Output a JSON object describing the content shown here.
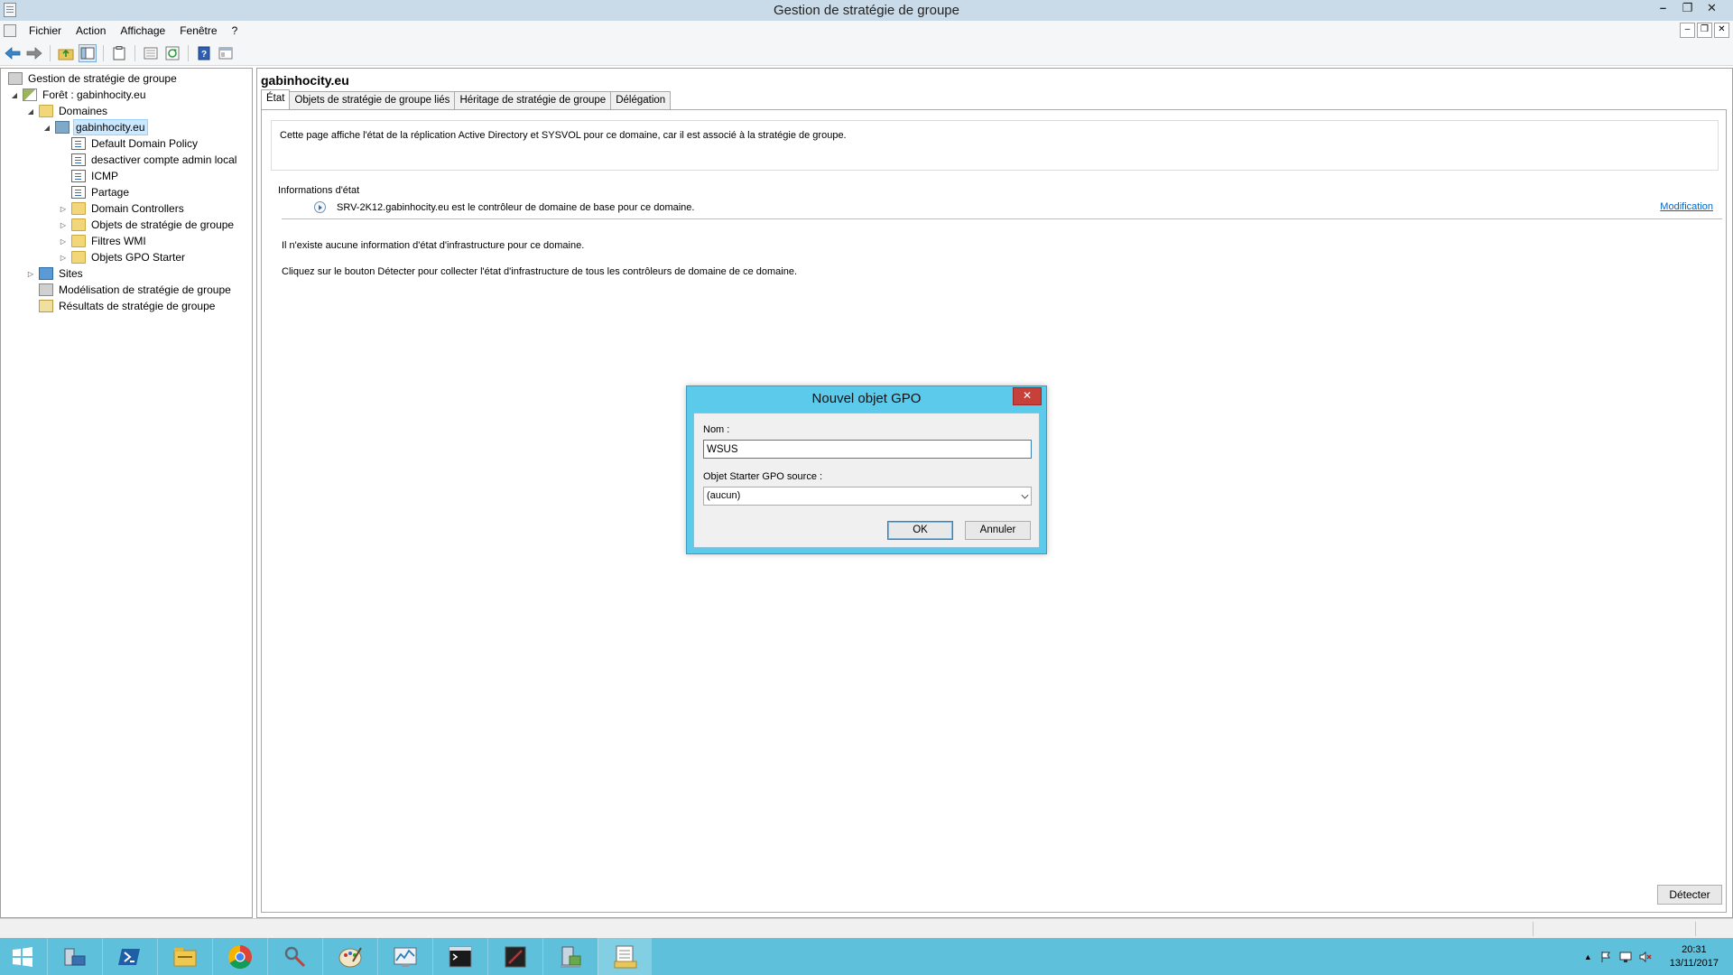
{
  "window": {
    "title": "Gestion de stratégie de groupe",
    "controls": {
      "minimize": "–",
      "restore": "❐",
      "close": "✕"
    }
  },
  "menu": {
    "items": [
      "Fichier",
      "Action",
      "Affichage",
      "Fenêtre",
      "?"
    ],
    "mdi_controls": {
      "minimize": "–",
      "restore": "❐",
      "close": "✕"
    }
  },
  "toolbar": {
    "icons": [
      "back-arrow-icon",
      "forward-arrow-icon",
      "up-folder-icon",
      "show-hide-tree-icon",
      "clipboard-icon",
      "properties-icon",
      "refresh-icon",
      "help-icon",
      "console-icon"
    ]
  },
  "tree": {
    "root": "Gestion de stratégie de groupe",
    "forest": "Forêt : gabinhocity.eu",
    "domains": "Domaines",
    "domain": "gabinhocity.eu",
    "gpo_links": [
      "Default Domain Policy",
      "desactiver compte admin local",
      "ICMP",
      "Partage"
    ],
    "containers": [
      "Domain Controllers",
      "Objets de stratégie de groupe",
      "Filtres WMI",
      "Objets GPO Starter"
    ],
    "sites": "Sites",
    "modeling": "Modélisation de stratégie de groupe",
    "results": "Résultats de stratégie de groupe",
    "expanders": {
      "expanded": "◢",
      "collapsed": "▷"
    }
  },
  "main": {
    "title": "gabinhocity.eu",
    "tabs": [
      "État",
      "Objets de stratégie de groupe liés",
      "Héritage de stratégie de groupe",
      "Délégation"
    ],
    "active_tab": "État",
    "info": "Cette page affiche l'état de la réplication Active Directory et SYSVOL pour ce domaine, car il est associé à la stratégie de groupe.",
    "section_label": "Informations d'état",
    "status_line": "SRV-2K12.gabinhocity.eu est le contrôleur de domaine de base pour ce domaine.",
    "modify_link": "Modification",
    "no_info": "Il n'existe aucune information d'état d'infrastructure pour ce domaine.",
    "instructions": "Cliquez sur le bouton Détecter pour collecter l'état d'infrastructure de tous les contrôleurs de domaine de ce domaine.",
    "detect_button": "Détecter"
  },
  "dialog": {
    "title": "Nouvel objet GPO",
    "close": "✕",
    "name_label": "Nom :",
    "name_value": "WSUS",
    "starter_label": "Objet Starter GPO source :",
    "starter_value": "(aucun)",
    "ok": "OK",
    "cancel": "Annuler"
  },
  "taskbar": {
    "items": [
      "server-manager-icon",
      "powershell-icon",
      "file-explorer-icon",
      "chrome-icon",
      "tools-icon",
      "paint-icon",
      "performance-monitor-icon",
      "cmd-icon",
      "terminal-icon",
      "dns-manager-icon",
      "group-policy-icon"
    ],
    "active_item": "group-policy-icon",
    "time": "20:31",
    "date": "13/11/2017"
  },
  "colors": {
    "titlebar": "#c9dbe8",
    "taskbar": "#5fc0dc",
    "dialog_frame": "#5ccaeb",
    "dialog_close": "#c7403a",
    "link": "#0066cc"
  }
}
